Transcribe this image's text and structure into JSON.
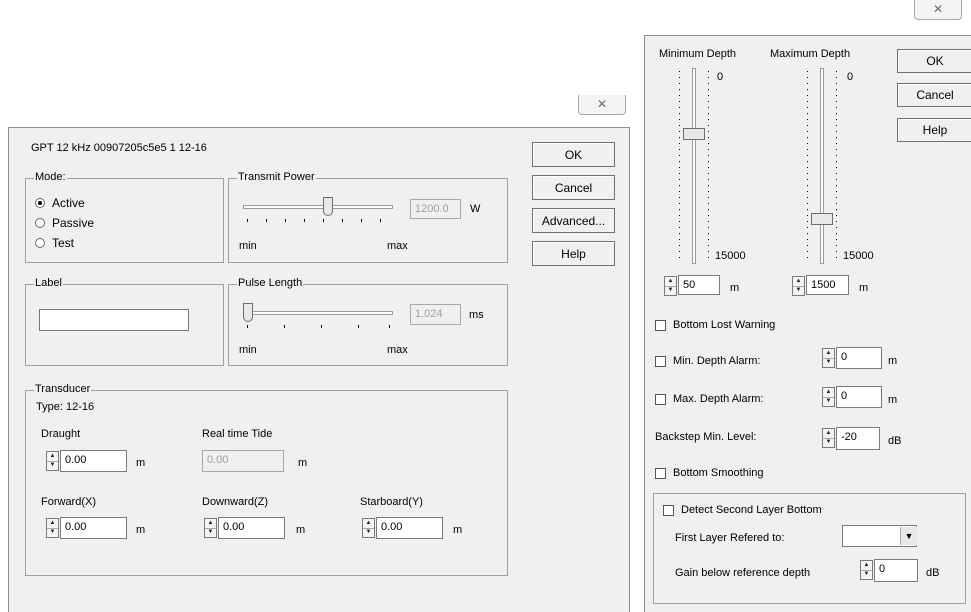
{
  "close_glyph": "✕",
  "left": {
    "header": "GPT  12 kHz 00907205c5e5 1 12-16",
    "buttons": {
      "ok": "OK",
      "cancel": "Cancel",
      "advanced": "Advanced...",
      "help": "Help"
    },
    "mode": {
      "label": "Mode:",
      "options": [
        "Active",
        "Passive",
        "Test"
      ],
      "selected": "Active"
    },
    "transmit_power": {
      "label": "Transmit Power",
      "value": "1200.0",
      "unit": "W",
      "min": "min",
      "max": "max"
    },
    "label_group": {
      "label": "Label",
      "value": ""
    },
    "pulse_length": {
      "label": "Pulse Length",
      "value": "1.024",
      "unit": "ms",
      "min": "min",
      "max": "max"
    },
    "transducer": {
      "label": "Transducer",
      "type": "Type:   12-16",
      "draught": {
        "label": "Draught",
        "value": "0.00",
        "unit": "m"
      },
      "tide": {
        "label": "Real time Tide",
        "value": "0.00",
        "unit": "m"
      },
      "forward": {
        "label": "Forward(X)",
        "value": "0.00",
        "unit": "m"
      },
      "downward": {
        "label": "Downward(Z)",
        "value": "0.00",
        "unit": "m"
      },
      "starboard": {
        "label": "Starboard(Y)",
        "value": "0.00",
        "unit": "m"
      }
    }
  },
  "right": {
    "buttons": {
      "ok": "OK",
      "cancel": "Cancel",
      "help": "Help"
    },
    "min_depth": {
      "label": "Minimum Depth",
      "top": "0",
      "bottom": "15000",
      "value": "50",
      "unit": "m"
    },
    "max_depth": {
      "label": "Maximum Depth",
      "top": "0",
      "bottom": "15000",
      "value": "1500",
      "unit": "m"
    },
    "bottom_lost": "Bottom Lost Warning",
    "min_alarm": {
      "label": "Min. Depth Alarm:",
      "value": "0",
      "unit": "m"
    },
    "max_alarm": {
      "label": "Max. Depth Alarm:",
      "value": "0",
      "unit": "m"
    },
    "backstep": {
      "label": "Backstep Min. Level:",
      "value": "-20",
      "unit": "dB"
    },
    "smoothing": "Bottom Smoothing",
    "second_layer": {
      "label": "Detect Second Layer Bottom",
      "ref_label": "First Layer Refered to:",
      "ref_value": "",
      "gain_label": "Gain below reference depth",
      "gain_value": "0",
      "gain_unit": "dB"
    }
  }
}
